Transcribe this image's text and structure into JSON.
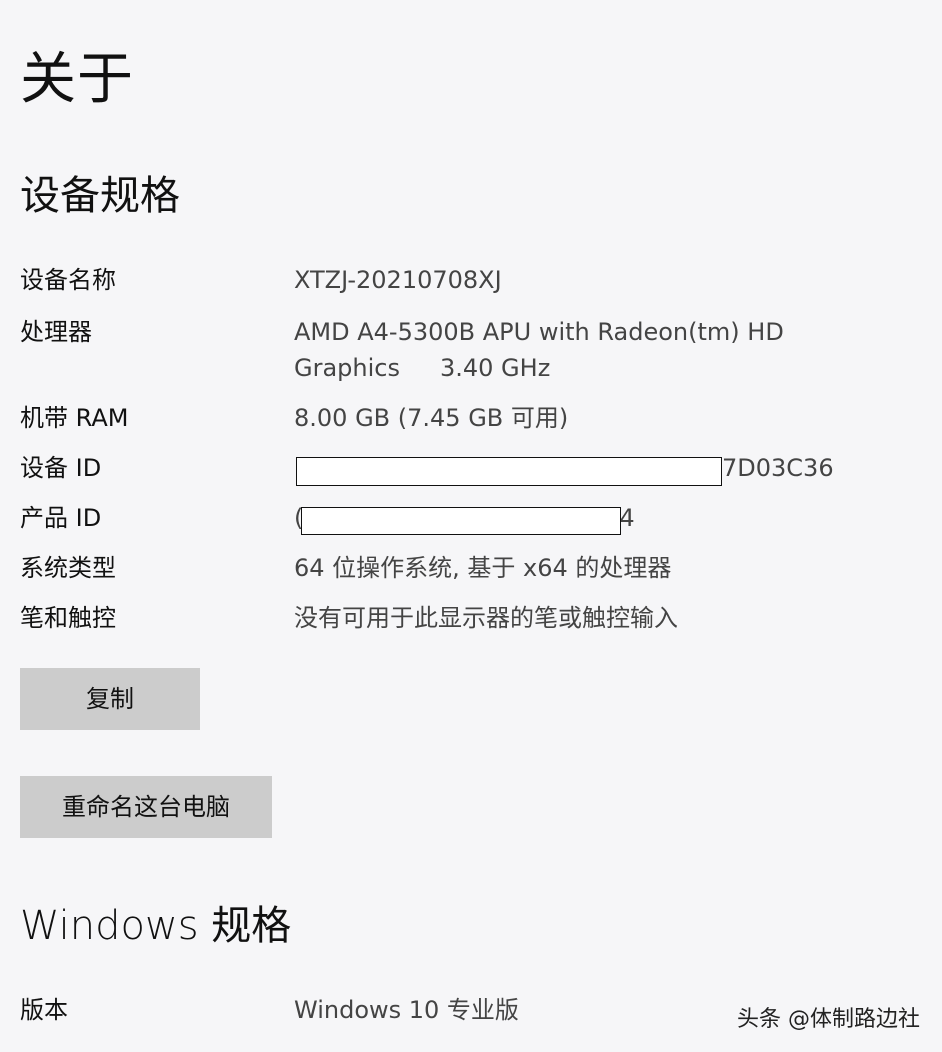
{
  "page": {
    "title": "关于"
  },
  "device_specs": {
    "title": "设备规格",
    "rows": [
      {
        "label": "设备名称",
        "value": "XTZJ-20210708XJ"
      },
      {
        "label": "处理器",
        "value_line1": "AMD A4-5300B APU with Radeon(tm) HD",
        "value_line2a": "Graphics",
        "value_line2b": "3.40 GHz"
      },
      {
        "label": "机带 RAM",
        "value": "8.00 GB (7.45 GB 可用)"
      },
      {
        "label": "设备 ID",
        "value_visible_suffix": "7D03C36",
        "redacted": true
      },
      {
        "label": "产品 ID",
        "value_visible_prefix": "(",
        "value_visible_suffix": "4",
        "redacted": true
      },
      {
        "label": "系统类型",
        "value": "64 位操作系统, 基于 x64 的处理器"
      },
      {
        "label": "笔和触控",
        "value": "没有可用于此显示器的笔或触控输入"
      }
    ]
  },
  "buttons": {
    "copy": "复制",
    "rename": "重命名这台电脑"
  },
  "windows_specs": {
    "title": "Windows 规格",
    "rows": [
      {
        "label": "版本",
        "value": "Windows 10 专业版"
      }
    ]
  },
  "watermark": "头条 @体制路边社"
}
